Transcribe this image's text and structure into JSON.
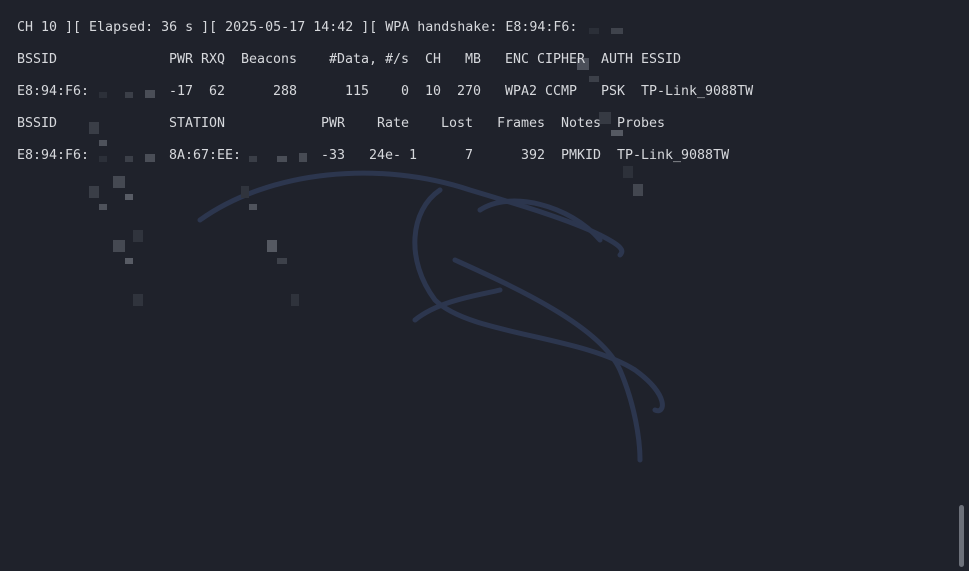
{
  "status_line": {
    "prefix": "CH 10 ][ Elapsed: 36 s ][ 2025-05-17 14:42 ][ WPA handshake: E8:94:F6:"
  },
  "ap_table": {
    "headers": {
      "bssid": "BSSID",
      "pwr": "PWR",
      "rxq": "RXQ",
      "beacons": "Beacons",
      "data": "#Data,",
      "rate_s": "#/s",
      "ch": "CH",
      "mb": "MB",
      "enc": "ENC",
      "cipher": "CIPHER",
      "auth": "AUTH",
      "essid": "ESSID"
    },
    "rows": [
      {
        "bssid_prefix": "E8:94:F6:",
        "pwr": "-17",
        "rxq": "62",
        "beacons": "288",
        "data": "115",
        "rate_s": "0",
        "ch": "10",
        "mb": "270",
        "enc": "WPA2",
        "cipher": "CCMP",
        "auth": "PSK",
        "essid": "TP-Link_9088TW"
      }
    ]
  },
  "station_table": {
    "headers": {
      "bssid": "BSSID",
      "station": "STATION",
      "pwr": "PWR",
      "rate": "Rate",
      "lost": "Lost",
      "frames": "Frames",
      "notes": "Notes",
      "probes": "Probes"
    },
    "rows": [
      {
        "bssid_prefix": "E8:94:F6:",
        "station_prefix": "8A:67:EE:",
        "pwr": "-33",
        "rate": "24e- 1",
        "lost": "7",
        "frames": "392",
        "notes": "PMKID",
        "probes": "TP-Link_9088TW"
      }
    ]
  },
  "colors": {
    "background": "#1f222b",
    "text": "#d6d8dc",
    "watermark": "#2f3a55",
    "scrollbar": "#6d717a"
  },
  "icons": {
    "watermark": "kali-dragon-icon"
  }
}
